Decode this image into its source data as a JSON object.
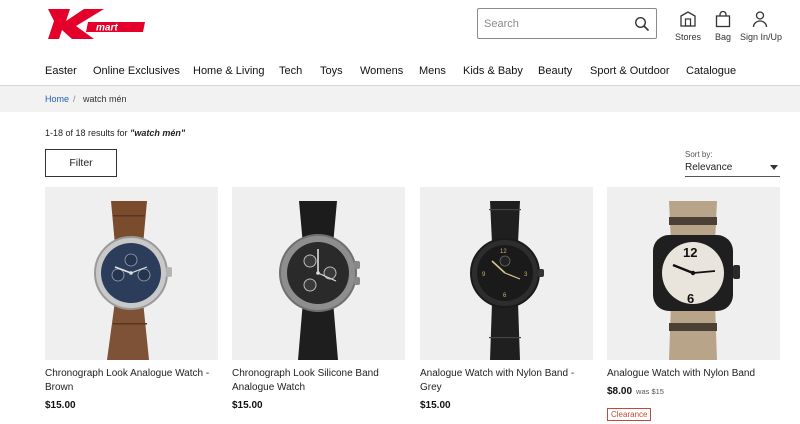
{
  "header": {
    "logo_text": "mart",
    "search": {
      "placeholder": "Search",
      "value": ""
    },
    "utilities": [
      {
        "label": "Stores",
        "icon": "store-icon"
      },
      {
        "label": "Bag",
        "icon": "bag-icon"
      },
      {
        "label": "Sign In/Up",
        "icon": "user-icon"
      }
    ]
  },
  "nav": {
    "items": [
      "Easter",
      "Online Exclusives",
      "Home & Living",
      "Tech",
      "Toys",
      "Womens",
      "Mens",
      "Kids & Baby",
      "Beauty",
      "Sport & Outdoor",
      "Catalogue"
    ]
  },
  "breadcrumb": {
    "home": "Home",
    "separator": "/",
    "current": "watch mén"
  },
  "results": {
    "prefix": "1-18 of 18 results for ",
    "query": "\"watch mén\""
  },
  "filter_label": "Filter",
  "sort": {
    "label": "Sort by:",
    "value": "Relevance"
  },
  "products": [
    {
      "name": "Chronograph Look Analogue Watch - Brown",
      "price": "$15.00",
      "was": "",
      "badge": ""
    },
    {
      "name": "Chronograph Look Silicone Band Analogue Watch",
      "price": "$15.00",
      "was": "",
      "badge": ""
    },
    {
      "name": "Analogue Watch with Nylon Band - Grey",
      "price": "$15.00",
      "was": "",
      "badge": ""
    },
    {
      "name": "Analogue Watch with Nylon Band",
      "price": "$8.00",
      "was": "was $15",
      "badge": "Clearance"
    }
  ],
  "colors": {
    "brand_red": "#e4002b",
    "link_blue": "#1f5fb0",
    "clearance": "#c24a36"
  }
}
